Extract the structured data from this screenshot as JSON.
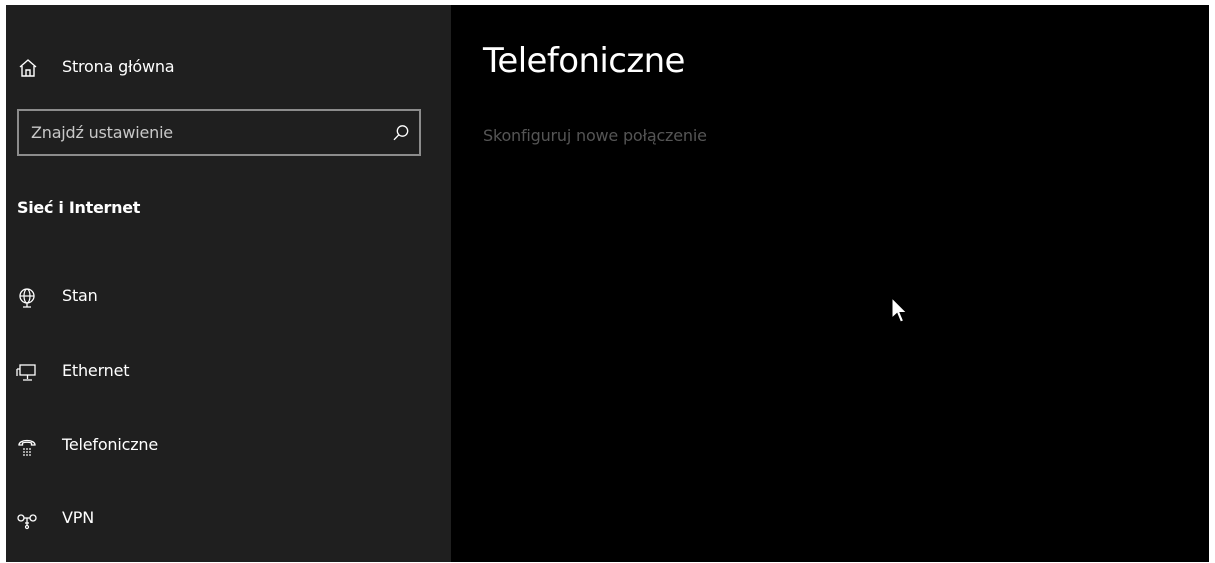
{
  "sidebar": {
    "home_label": "Strona główna",
    "search_placeholder": "Znajdź ustawienie",
    "section_title": "Sieć i Internet",
    "items": [
      {
        "label": "Stan",
        "icon": "globe-icon"
      },
      {
        "label": "Ethernet",
        "icon": "ethernet-icon"
      },
      {
        "label": "Telefoniczne",
        "icon": "dialup-icon"
      },
      {
        "label": "VPN",
        "icon": "vpn-icon"
      }
    ]
  },
  "main": {
    "title": "Telefoniczne",
    "setup_link": "Skonfiguruj nowe połączenie"
  },
  "colors": {
    "sidebar_bg": "#1f1f1f",
    "main_bg": "#000000",
    "text": "#ffffff",
    "disabled_link": "#555555",
    "search_border": "#8c8c8c"
  }
}
